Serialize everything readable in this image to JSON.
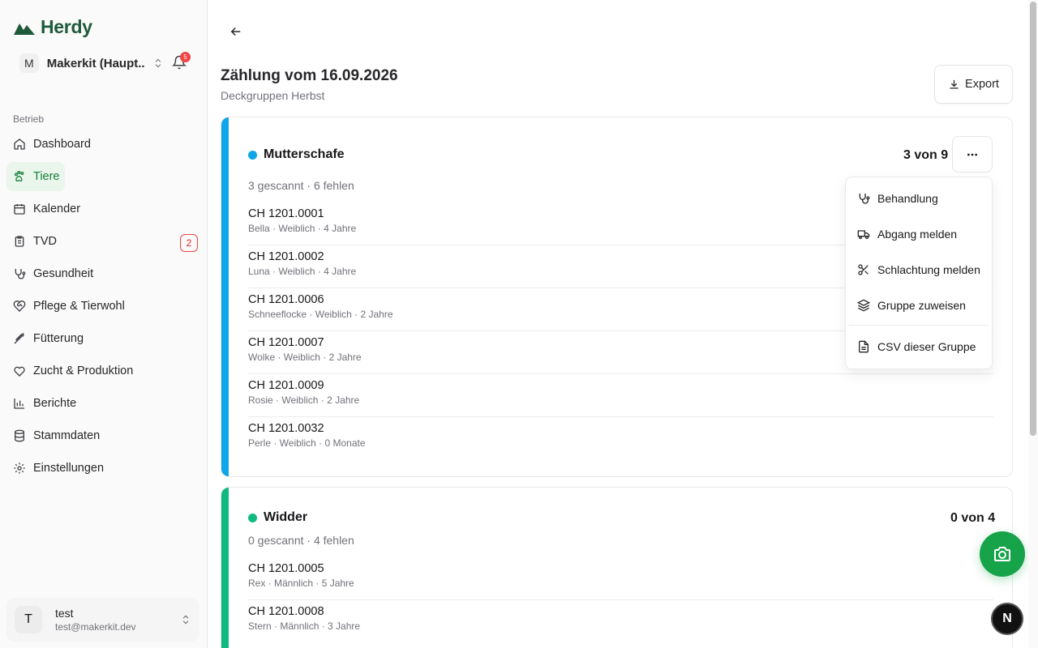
{
  "app": {
    "name": "Herdy"
  },
  "org": {
    "initial": "M",
    "name": "Makerkit (Haupt...",
    "notifications": "5"
  },
  "sidebar": {
    "section_label": "Betrieb",
    "items": [
      {
        "label": "Dashboard",
        "icon": "home-icon"
      },
      {
        "label": "Tiere",
        "icon": "paw-icon",
        "active": true
      },
      {
        "label": "Kalender",
        "icon": "calendar-icon"
      },
      {
        "label": "TVD",
        "icon": "clipboard-icon",
        "badge": "2"
      },
      {
        "label": "Gesundheit",
        "icon": "stethoscope-icon"
      },
      {
        "label": "Pflege & Tierwohl",
        "icon": "heart-handshake-icon"
      },
      {
        "label": "Fütterung",
        "icon": "wheat-icon"
      },
      {
        "label": "Zucht & Produktion",
        "icon": "heart-icon"
      },
      {
        "label": "Berichte",
        "icon": "bar-chart-icon"
      },
      {
        "label": "Stammdaten",
        "icon": "database-icon"
      },
      {
        "label": "Einstellungen",
        "icon": "gear-icon"
      }
    ]
  },
  "user": {
    "initial": "T",
    "name": "test",
    "email": "test@makerkit.dev"
  },
  "page": {
    "title": "Zählung vom 16.09.2026",
    "subtitle": "Deckgruppen Herbst",
    "export_label": "Export"
  },
  "groups": [
    {
      "name": "Mutterschafe",
      "count": "3 von 9",
      "status": "3 gescannt · 6 fehlen",
      "color": "#0ea5e9",
      "animals": [
        {
          "id": "CH 1201.0001",
          "meta": "Bella · Weiblich · 4 Jahre"
        },
        {
          "id": "CH 1201.0002",
          "meta": "Luna · Weiblich · 4 Jahre"
        },
        {
          "id": "CH 1201.0006",
          "meta": "Schneeflocke · Weiblich · 2 Jahre"
        },
        {
          "id": "CH 1201.0007",
          "meta": "Wolke · Weiblich · 2 Jahre"
        },
        {
          "id": "CH 1201.0009",
          "meta": "Rosie · Weiblich · 2 Jahre"
        },
        {
          "id": "CH 1201.0032",
          "meta": "Perle · Weiblich · 0 Monate"
        }
      ]
    },
    {
      "name": "Widder",
      "count": "0 von 4",
      "status": "0 gescannt · 4 fehlen",
      "color": "#10b981",
      "animals": [
        {
          "id": "CH 1201.0005",
          "meta": "Rex · Männlich · 5 Jahre"
        },
        {
          "id": "CH 1201.0008",
          "meta": "Stern · Männlich · 3 Jahre"
        }
      ]
    }
  ],
  "menu": {
    "items": [
      {
        "label": "Behandlung",
        "icon": "stethoscope-icon"
      },
      {
        "label": "Abgang melden",
        "icon": "truck-icon"
      },
      {
        "label": "Schlachtung melden",
        "icon": "scissors-icon"
      },
      {
        "label": "Gruppe zuweisen",
        "icon": "layers-icon"
      }
    ],
    "footer_item": {
      "label": "CSV dieser Gruppe",
      "icon": "file-text-icon"
    }
  },
  "next_badge": "N",
  "colors": {
    "brand": "#1f5a3a",
    "accent": "#16a34a",
    "danger": "#ef4444"
  }
}
